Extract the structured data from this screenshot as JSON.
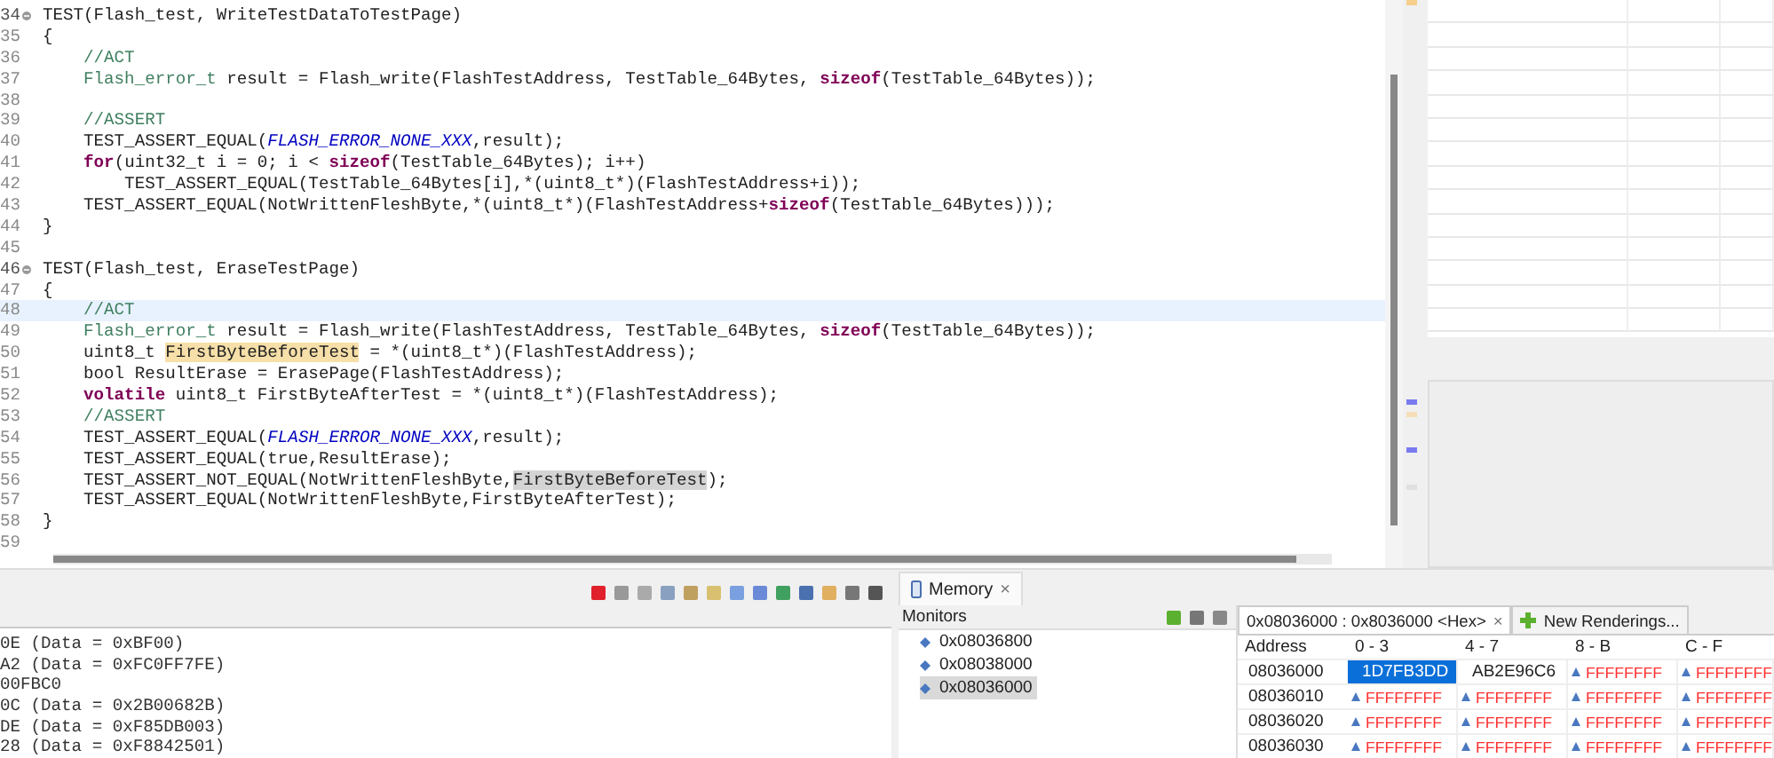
{
  "editor": {
    "lines": [
      {
        "number": "34",
        "fold": true,
        "current": false,
        "segments": [
          {
            "text": "TEST(Flash_test, WriteTestDataToTestPage)",
            "kind": "plain"
          }
        ]
      },
      {
        "number": "35",
        "fold": false,
        "current": false,
        "segments": [
          {
            "text": "{",
            "kind": "plain"
          }
        ]
      },
      {
        "number": "36",
        "fold": false,
        "current": false,
        "segments": [
          {
            "text": "    //ACT",
            "kind": "comment"
          }
        ]
      },
      {
        "number": "37",
        "fold": false,
        "current": false,
        "segments": [
          {
            "text": "    Flash_error_t",
            "kind": "type"
          },
          {
            "text": " result = Flash_write(FlashTestAddress, TestTable_64Bytes, ",
            "kind": "plain"
          },
          {
            "text": "sizeof",
            "kind": "keyword"
          },
          {
            "text": "(TestTable_64Bytes));",
            "kind": "plain"
          }
        ]
      },
      {
        "number": "38",
        "fold": false,
        "current": false
      },
      {
        "number": "39",
        "fold": false,
        "current": false,
        "segments": [
          {
            "text": "    //ASSERT",
            "kind": "comment"
          }
        ]
      },
      {
        "number": "40",
        "fold": false,
        "current": false,
        "segments": [
          {
            "text": "    TEST_ASSERT_EQUAL(",
            "kind": "plain"
          },
          {
            "text": "FLASH_ERROR_NONE_XXX",
            "kind": "constant"
          },
          {
            "text": ",result);",
            "kind": "plain"
          }
        ]
      },
      {
        "number": "41",
        "fold": false,
        "current": false,
        "segments": [
          {
            "text": "    for",
            "kind": "keyword"
          },
          {
            "text": "(uint32_t i = 0; i < ",
            "kind": "plain"
          },
          {
            "text": "sizeof",
            "kind": "keyword"
          },
          {
            "text": "(TestTable_64Bytes); i++)",
            "kind": "plain"
          }
        ]
      },
      {
        "number": "42",
        "fold": false,
        "current": false,
        "segments": [
          {
            "text": "        TEST_ASSERT_EQUAL(TestTable_64Bytes[i],*(uint8_t*)(FlashTestAddress+i));",
            "kind": "plain"
          }
        ]
      },
      {
        "number": "43",
        "fold": false,
        "current": false,
        "segments": [
          {
            "text": "    TEST_ASSERT_EQUAL(NotWrittenFleshByte,*(uint8_t*)(FlashTestAddress+",
            "kind": "plain"
          },
          {
            "text": "sizeof",
            "kind": "keyword"
          },
          {
            "text": "(TestTable_64Bytes)));",
            "kind": "plain"
          }
        ]
      },
      {
        "number": "44",
        "fold": false,
        "current": false,
        "segments": [
          {
            "text": "}",
            "kind": "plain"
          }
        ]
      },
      {
        "number": "45",
        "fold": false,
        "current": false
      },
      {
        "number": "46",
        "fold": true,
        "current": false,
        "segments": [
          {
            "text": "TEST(Flash_test, EraseTestPage)",
            "kind": "plain"
          }
        ]
      },
      {
        "number": "47",
        "fold": false,
        "current": false,
        "segments": [
          {
            "text": "{",
            "kind": "plain"
          }
        ]
      },
      {
        "number": "48",
        "fold": false,
        "current": true,
        "segments": [
          {
            "text": "    //ACT",
            "kind": "comment"
          }
        ]
      },
      {
        "number": "49",
        "fold": false,
        "current": false,
        "segments": [
          {
            "text": "    Flash_error_t",
            "kind": "type"
          },
          {
            "text": " result = Flash_write(FlashTestAddress, TestTable_64Bytes, ",
            "kind": "plain"
          },
          {
            "text": "sizeof",
            "kind": "keyword"
          },
          {
            "text": "(TestTable_64Bytes));",
            "kind": "plain"
          }
        ]
      },
      {
        "number": "50",
        "fold": false,
        "current": false,
        "segments": [
          {
            "text": "    uint8_t ",
            "kind": "plain"
          },
          {
            "text": "FirstByteBeforeTest",
            "kind": "occurrence"
          },
          {
            "text": " = *(uint8_t*)(FlashTestAddress);",
            "kind": "plain"
          }
        ]
      },
      {
        "number": "51",
        "fold": false,
        "current": false,
        "segments": [
          {
            "text": "    bool ResultErase = ErasePage(FlashTestAddress);",
            "kind": "plain"
          }
        ]
      },
      {
        "number": "52",
        "fold": false,
        "current": false,
        "segments": [
          {
            "text": "    volatile",
            "kind": "keyword"
          },
          {
            "text": " uint8_t FirstByteAfterTest = *(uint8_t*)(FlashTestAddress);",
            "kind": "plain"
          }
        ]
      },
      {
        "number": "53",
        "fold": false,
        "current": false,
        "segments": [
          {
            "text": "    //ASSERT",
            "kind": "comment"
          }
        ]
      },
      {
        "number": "54",
        "fold": false,
        "current": false,
        "segments": [
          {
            "text": "    TEST_ASSERT_EQUAL(",
            "kind": "plain"
          },
          {
            "text": "FLASH_ERROR_NONE_XXX",
            "kind": "constant"
          },
          {
            "text": ",result);",
            "kind": "plain"
          }
        ]
      },
      {
        "number": "55",
        "fold": false,
        "current": false,
        "segments": [
          {
            "text": "    TEST_ASSERT_EQUAL(true,ResultErase);",
            "kind": "plain"
          }
        ]
      },
      {
        "number": "56",
        "fold": false,
        "current": false,
        "segments": [
          {
            "text": "    TEST_ASSERT_NOT_EQUAL(NotWrittenFleshByte,",
            "kind": "plain"
          },
          {
            "text": "FirstByteBeforeTest",
            "kind": "selection"
          },
          {
            "text": ");",
            "kind": "plain"
          }
        ]
      },
      {
        "number": "57",
        "fold": false,
        "current": false,
        "segments": [
          {
            "text": "    TEST_ASSERT_EQUAL(NotWrittenFleshByte,FirstByteAfterTest);",
            "kind": "plain"
          }
        ]
      },
      {
        "number": "58",
        "fold": false,
        "current": false,
        "segments": [
          {
            "text": "}",
            "kind": "plain"
          }
        ]
      },
      {
        "number": "59",
        "fold": false,
        "current": false
      }
    ]
  },
  "console": {
    "lines": [
      "0E (Data = 0xBF00)",
      "A2 (Data = 0xFC0FF7FE)",
      "00FBC0",
      "0C (Data = 0x2B00682B)",
      "DE (Data = 0xF85DB003)",
      "28 (Data = 0xF8842501)"
    ]
  },
  "memory": {
    "tab": "Memory",
    "tab_close": "×",
    "monitors_label": "Monitors",
    "monitors": [
      {
        "address": "0x08036800",
        "selected": false
      },
      {
        "address": "0x08038000",
        "selected": false
      },
      {
        "address": "0x08036000",
        "selected": true
      }
    ],
    "rendering_tab": "0x08036000 : 0x8036000 <Hex>",
    "rendering_close": "×",
    "new_renderings": "New Renderings...",
    "columns": [
      "Address",
      "0 - 3",
      "4 - 7",
      "8 - B",
      "C - F"
    ],
    "rows": [
      {
        "cells": [
          {
            "kind": "address",
            "value": "08036000"
          },
          {
            "kind": "hex",
            "value": "1D7FB3DD",
            "changed": false,
            "selected": true
          },
          {
            "kind": "hex",
            "value": "AB2E96C6",
            "changed": false,
            "selected": false
          },
          {
            "kind": "hex",
            "value": "FFFFFFFF",
            "changed": true,
            "selected": false
          },
          {
            "kind": "hex",
            "value": "FFFFFFFF",
            "changed": true,
            "selected": false
          }
        ]
      },
      {
        "cells": [
          {
            "kind": "address",
            "value": "08036010"
          },
          {
            "kind": "hex",
            "value": "FFFFFFFF",
            "changed": true,
            "selected": false
          },
          {
            "kind": "hex",
            "value": "FFFFFFFF",
            "changed": true,
            "selected": false
          },
          {
            "kind": "hex",
            "value": "FFFFFFFF",
            "changed": true,
            "selected": false
          },
          {
            "kind": "hex",
            "value": "FFFFFFFF",
            "changed": true,
            "selected": false
          }
        ]
      },
      {
        "cells": [
          {
            "kind": "address",
            "value": "08036020"
          },
          {
            "kind": "hex",
            "value": "FFFFFFFF",
            "changed": true,
            "selected": false
          },
          {
            "kind": "hex",
            "value": "FFFFFFFF",
            "changed": true,
            "selected": false
          },
          {
            "kind": "hex",
            "value": "FFFFFFFF",
            "changed": true,
            "selected": false
          },
          {
            "kind": "hex",
            "value": "FFFFFFFF",
            "changed": true,
            "selected": false
          }
        ]
      },
      {
        "cells": [
          {
            "kind": "address",
            "value": "08036030"
          },
          {
            "kind": "hex",
            "value": "FFFFFFFF",
            "changed": true,
            "selected": false
          },
          {
            "kind": "hex",
            "value": "FFFFFFFF",
            "changed": true,
            "selected": false
          },
          {
            "kind": "hex",
            "value": "FFFFFFFF",
            "changed": true,
            "selected": false
          },
          {
            "kind": "hex",
            "value": "FFFFFFFF",
            "changed": true,
            "selected": false
          }
        ]
      }
    ]
  }
}
